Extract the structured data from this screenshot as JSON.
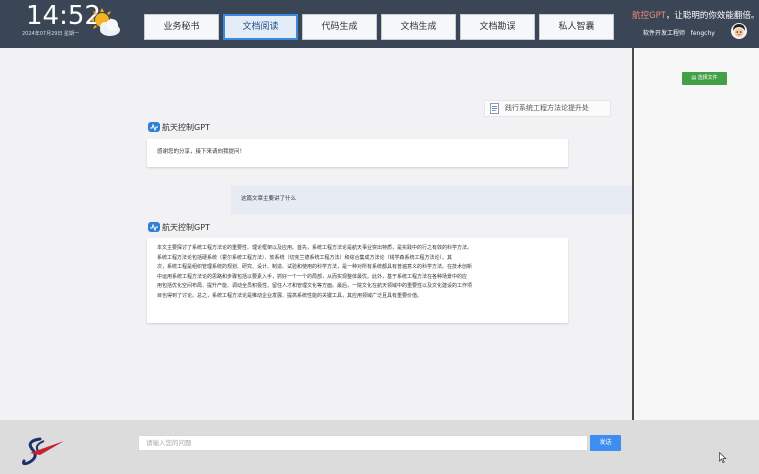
{
  "header": {
    "time": "14:52",
    "date": "2024年07月29日  星期一",
    "tabs": [
      {
        "label": "业务秘书",
        "active": false
      },
      {
        "label": "文档阅读",
        "active": true
      },
      {
        "label": "代码生成",
        "active": false
      },
      {
        "label": "文档生成",
        "active": false
      },
      {
        "label": "文档勘误",
        "active": false
      },
      {
        "label": "私人智囊",
        "active": false
      }
    ],
    "brand_name": "航控GPT",
    "brand_slogan": "，让聪明的你效能翻倍。",
    "user_role": "软件开发工程师",
    "user_name": "fengchy"
  },
  "sidebar": {
    "select_file_label": "选择文件"
  },
  "chat": {
    "file_reference": "践行系统工程方法论提升处",
    "messages": [
      {
        "role": "assistant",
        "name": "航天控制GPT",
        "text": "感谢您的分享，接下来请向我提问！"
      },
      {
        "role": "user",
        "text": "这篇文章主要讲了什么"
      },
      {
        "role": "assistant",
        "name": "航天控制GPT",
        "lines": [
          "本文主要探讨了系统工程方法论的重要性、理论框架以及应用。首先，系统工程方法论是航天事业突出特质，是实践中的行之有效的科学方法。",
          "系统工程方法论包括硬系统（霍尔系统工程方法）、软系统（切克兰德系统工程方法）和综合集成方法论（钱学森系统工程方法论）。其",
          "次，系统工程是组织管理系统的规划、研究、设计、制造、试验和使用的科学方法，是一种对所有系统都具有普遍意义的科学方法。在技术创新",
          "中运用系统工程方法论的思路和步骤包括以要素入手，抓好一个一个的局部，从而实现整体最优。此外，基于系统工程方法在各种场景中的应",
          "用包括优化空间布局、提升产能、调动全员积极性、留住人才和管理文化等方面。最后，一院文化在航天领域中的重要性以及文化建设的工作项",
          "目也得到了讨论。总之，系统工程方法论是推动企业发展、提高系统性能的关键工具，其应用领域广泛且具有重要价值。"
        ]
      }
    ]
  },
  "composer": {
    "placeholder": "请输入您的问题",
    "send_label": "发送"
  }
}
